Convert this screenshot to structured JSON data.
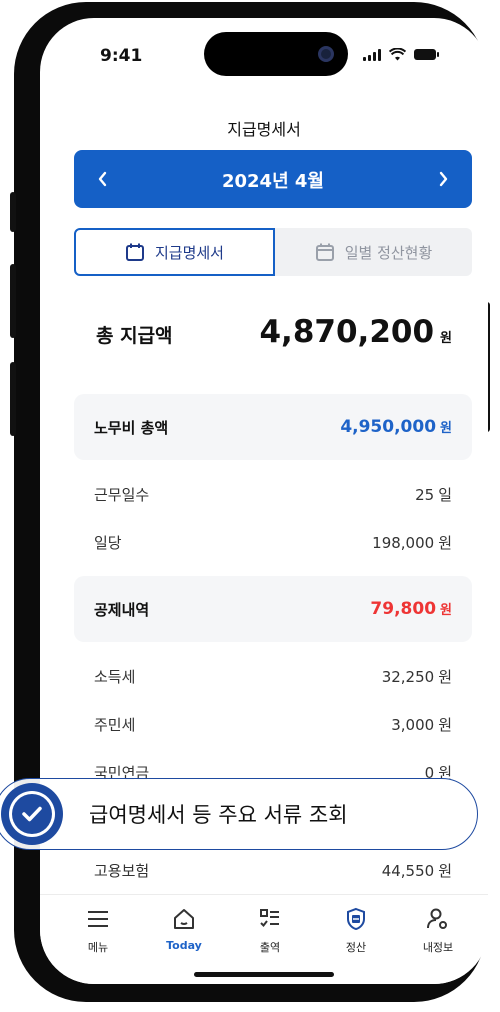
{
  "status_bar": {
    "time": "9:41"
  },
  "header": {
    "title": "지급명세서"
  },
  "month_nav": {
    "label": "2024년 4월",
    "prev": "‹",
    "next": "›"
  },
  "tabs": [
    {
      "label": "지급명세서",
      "active": true,
      "icon": "calendar-icon"
    },
    {
      "label": "일별 정산현황",
      "active": false,
      "icon": "calendar-icon"
    }
  ],
  "total": {
    "label": "총 지급액",
    "amount": "4,870,200",
    "unit": "원"
  },
  "labor": {
    "label": "노무비 총액",
    "amount": "4,950,000",
    "unit": "원",
    "color": "#1e63c8"
  },
  "labor_details": [
    {
      "label": "근무일수",
      "value": "25",
      "unit": "일"
    },
    {
      "label": "일당",
      "value": "198,000",
      "unit": "원"
    }
  ],
  "deduction": {
    "label": "공제내역",
    "amount": "79,800",
    "unit": "원",
    "color": "#ee3535"
  },
  "deduction_details": [
    {
      "label": "소득세",
      "value": "32,250",
      "unit": "원"
    },
    {
      "label": "주민세",
      "value": "3,000",
      "unit": "원"
    },
    {
      "label": "국민연금",
      "value": "0",
      "unit": "원"
    },
    {
      "label": "고용보험",
      "value": "44,550",
      "unit": "원"
    }
  ],
  "banner": {
    "text": "급여명세서 등 주요 서류 조회",
    "icon": "check-circle-icon"
  },
  "tabbar": [
    {
      "label": "메뉴",
      "icon": "menu-icon",
      "active": false
    },
    {
      "label": "Today",
      "icon": "home-icon",
      "active": true
    },
    {
      "label": "출역",
      "icon": "checklist-icon",
      "active": false
    },
    {
      "label": "정산",
      "icon": "settlement-icon",
      "active": false
    },
    {
      "label": "내정보",
      "icon": "user-settings-icon",
      "active": false
    }
  ]
}
